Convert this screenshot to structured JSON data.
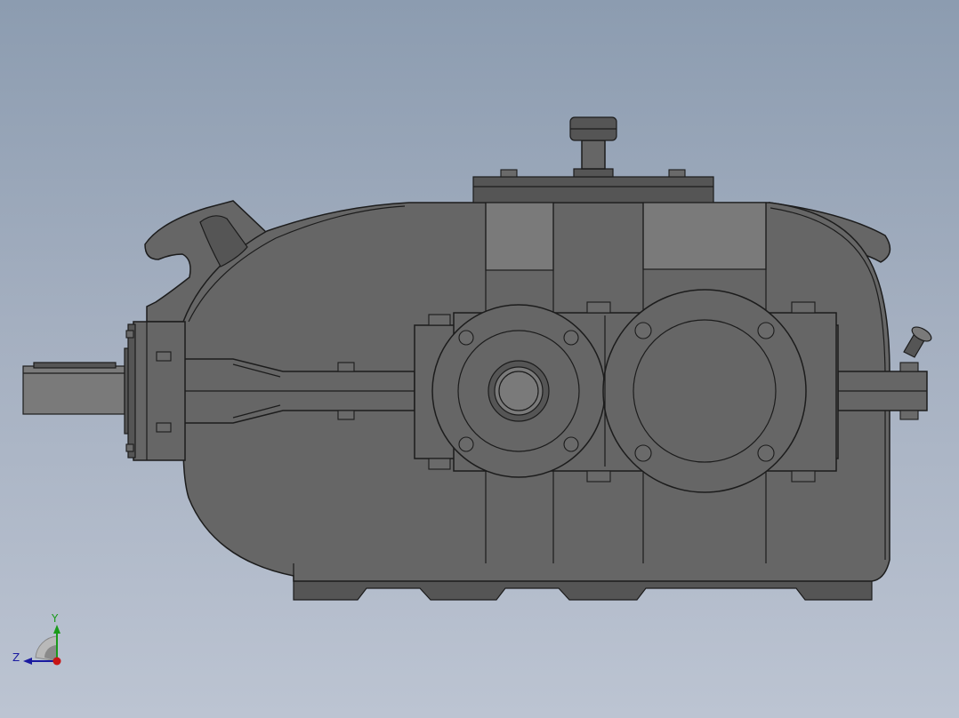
{
  "viewport": {
    "background_top": "#8c9cb0",
    "background_bottom": "#bcc4d2"
  },
  "model": {
    "body_color": "#666666",
    "edge_color": "#1c1c1c",
    "panel_color": "#7a7a7a"
  },
  "triad": {
    "y_label": "Y",
    "z_label": "Z",
    "y_color": "#1a9a1a",
    "z_color": "#1a1aa0",
    "x_color": "#c81414"
  }
}
